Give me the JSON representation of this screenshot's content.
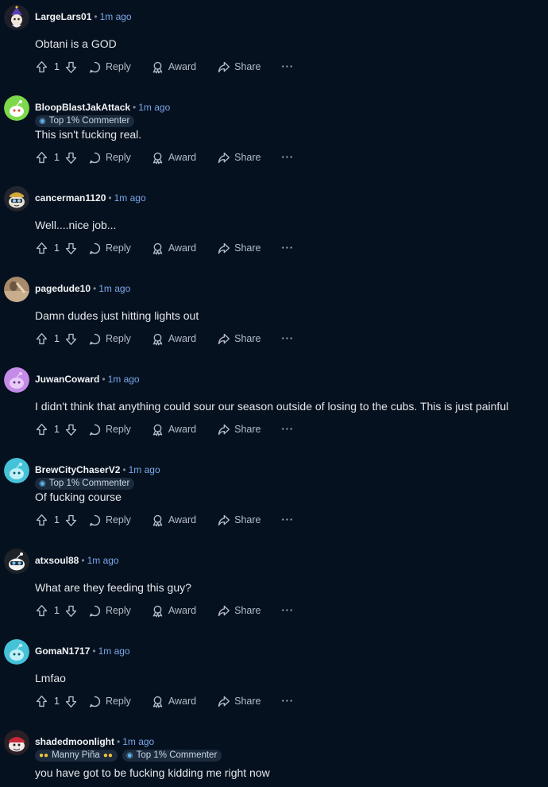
{
  "actions": {
    "reply": "Reply",
    "award": "Award",
    "share": "Share",
    "more": "···"
  },
  "comments": [
    {
      "username": "LargeLars01",
      "time": "1m ago",
      "text": "Obtani is a GOD",
      "votes": "1",
      "avatar": "wizard-avatar",
      "flairs": []
    },
    {
      "username": "BloopBlastJakAttack",
      "time": "1m ago",
      "text": "This isn't fucking real.",
      "votes": "1",
      "avatar": "snoo-green-avatar",
      "flairs": [
        "Top 1% Commenter"
      ]
    },
    {
      "username": "cancerman1120",
      "time": "1m ago",
      "text": "Well....nice job...",
      "votes": "1",
      "avatar": "snoo-cap-avatar",
      "flairs": []
    },
    {
      "username": "pagedude10",
      "time": "1m ago",
      "text": "Damn dudes just hitting lights out",
      "votes": "1",
      "avatar": "photo-avatar",
      "flairs": []
    },
    {
      "username": "JuwanCoward",
      "time": "1m ago",
      "text": "I didn't think that anything could sour our season outside of losing to the cubs. This is just painful",
      "votes": "1",
      "avatar": "snoo-purple-avatar",
      "flairs": []
    },
    {
      "username": "BrewCityChaserV2",
      "time": "1m ago",
      "text": "Of fucking course",
      "votes": "1",
      "avatar": "snoo-cyan-avatar",
      "flairs": [
        "Top 1% Commenter"
      ]
    },
    {
      "username": "atxsoul88",
      "time": "1m ago",
      "text": "What are they feeding this guy?",
      "votes": "1",
      "avatar": "snoo-glasses-avatar",
      "flairs": []
    },
    {
      "username": "GomaN1717",
      "time": "1m ago",
      "text": "Lmfao",
      "votes": "1",
      "avatar": "snoo-cyan-avatar",
      "flairs": []
    },
    {
      "username": "shadedmoonlight",
      "time": "1m ago",
      "text": "you have got to be fucking kidding me right now",
      "votes": "",
      "avatar": "snoo-red-avatar",
      "flairs": [
        "Manny Piña",
        "Top 1% Commenter"
      ]
    }
  ]
}
